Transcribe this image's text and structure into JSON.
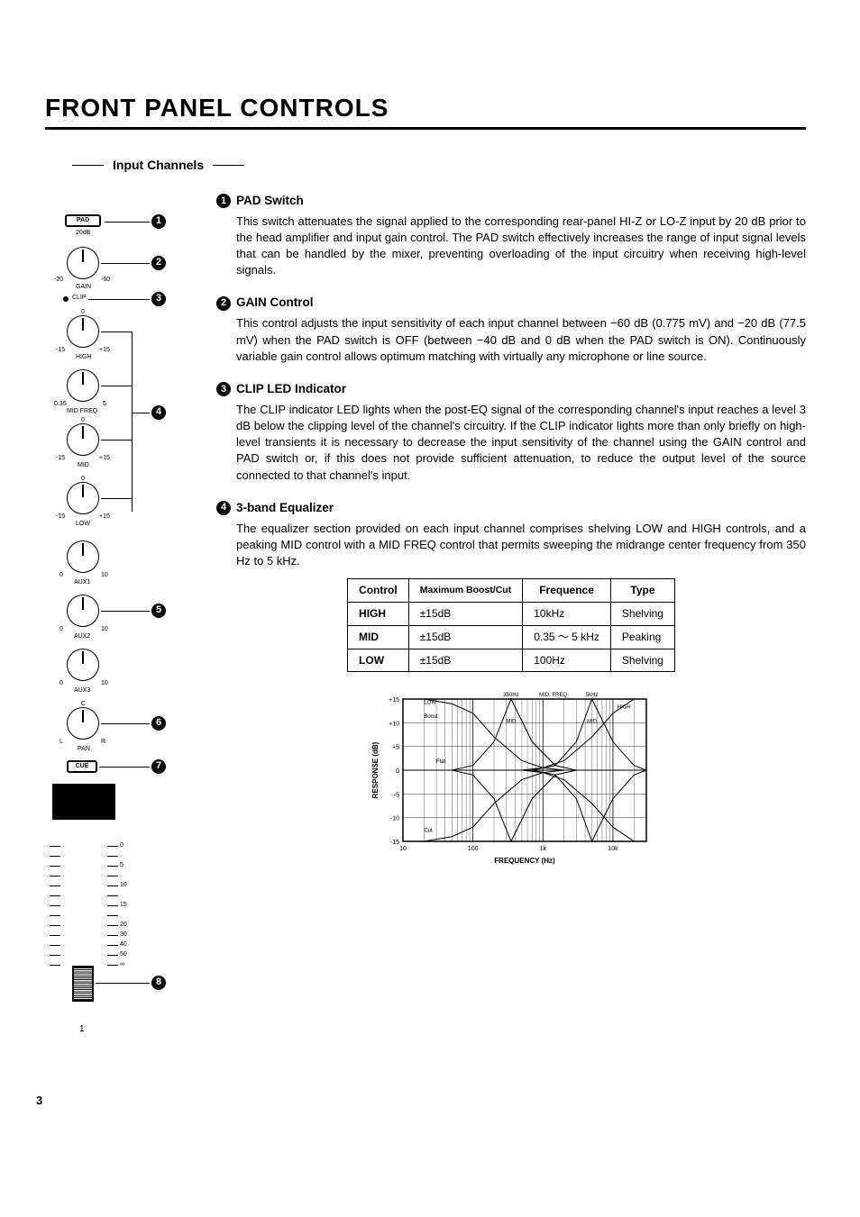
{
  "page_title": "FRONT PANEL CONTROLS",
  "subsection": "Input Channels",
  "page_number": "3",
  "channel_number": "1",
  "diagram": {
    "pad_label": "PAD",
    "pad_value": "20dB",
    "gain_left": "-20",
    "gain_right": "-60",
    "gain_label": "GAIN",
    "clip_label": "CLIP",
    "high_top": "0",
    "high_left": "-15",
    "high_right": "+15",
    "high_label": "HIGH",
    "midfreq_left": "0.35",
    "midfreq_right": "5",
    "midfreq_label": "MID FREQ",
    "mid_top": "0",
    "mid_left": "-15",
    "mid_right": "+15",
    "mid_label": "MID",
    "low_top": "0",
    "low_left": "-15",
    "low_right": "+15",
    "low_label": "LOW",
    "aux1_left": "0",
    "aux1_right": "10",
    "aux1_label": "AUX1",
    "aux2_left": "0",
    "aux2_right": "10",
    "aux2_label": "AUX2",
    "aux3_left": "0",
    "aux3_right": "10",
    "aux3_label": "AUX3",
    "pan_top": "C",
    "pan_left": "L",
    "pan_right": "R",
    "pan_label": "PAN",
    "cue_label": "CUE",
    "fader_marks": [
      "0",
      "5",
      "10",
      "15",
      "20",
      "30",
      "40",
      "50",
      "∞"
    ]
  },
  "sections": [
    {
      "num": "1",
      "title": "PAD Switch",
      "body": "This switch attenuates the signal applied to the corresponding rear-panel HI-Z or LO-Z input by 20 dB prior to the head amplifier and input gain control. The PAD switch effectively increases the range of input signal levels that can be handled by the mixer, preventing overloading of the input circuitry when receiving high-level signals."
    },
    {
      "num": "2",
      "title": "GAIN Control",
      "body": "This control adjusts the input sensitivity of each input channel between −60 dB (0.775 mV) and −20 dB (77.5 mV) when the PAD switch is OFF (between −40 dB and 0 dB when the PAD switch is ON). Continuously variable gain control allows optimum matching with virtually any microphone or line source."
    },
    {
      "num": "3",
      "title": "CLIP LED Indicator",
      "body": "The CLIP indicator LED lights when the post-EQ signal of the corresponding channel's input reaches a level 3 dB below the clipping level of the channel's circuitry. If the CLIP indicator lights more than only briefly on high-level transients it is necessary to decrease the input sensitivity of the channel using the GAIN control and PAD switch or, if this does not provide sufficient attenuation, to reduce the output level of the source connected to that channel's input."
    },
    {
      "num": "4",
      "title": "3-band Equalizer",
      "body": "The equalizer section provided on each input channel comprises shelving LOW and HIGH controls, and a peaking MID control with a MID FREQ control that permits sweeping the midrange center frequency from 350 Hz to 5 kHz."
    }
  ],
  "eq_table": {
    "headers": [
      "Control",
      "Maximum Boost/Cut",
      "Frequence",
      "Type"
    ],
    "rows": [
      [
        "HIGH",
        "±15dB",
        "10kHz",
        "Shelving"
      ],
      [
        "MID",
        "±15dB",
        "0.35 ～ 5 kHz",
        "Peaking"
      ],
      [
        "LOW",
        "±15dB",
        "100Hz",
        "Shelving"
      ]
    ]
  },
  "chart_data": {
    "type": "line",
    "title": "",
    "xlabel": "FREQUENCY (Hz)",
    "ylabel": "RESPONSE (dB)",
    "xscale": "log",
    "xlim": [
      10,
      30000
    ],
    "ylim": [
      -15,
      15
    ],
    "xticks": [
      10,
      100,
      1000,
      10000
    ],
    "xtick_labels": [
      "10",
      "100",
      "1k",
      "10k"
    ],
    "yticks": [
      -15,
      -10,
      -5,
      0,
      5,
      10,
      15
    ],
    "annotations": [
      "LOW",
      "Boost",
      "MID",
      "MID. FREQ",
      "HIGH",
      "Flat",
      "Cut",
      "350Hz",
      "5kHz"
    ],
    "series": [
      {
        "name": "LOW boost",
        "x": [
          10,
          20,
          50,
          100,
          200,
          500,
          1000,
          2000,
          20000
        ],
        "y": [
          15,
          15,
          14,
          12,
          7,
          2,
          0.5,
          0,
          0
        ]
      },
      {
        "name": "LOW cut",
        "x": [
          10,
          20,
          50,
          100,
          200,
          500,
          1000,
          2000,
          20000
        ],
        "y": [
          -15,
          -15,
          -14,
          -12,
          -7,
          -2,
          -0.5,
          0,
          0
        ]
      },
      {
        "name": "MID boost 350Hz",
        "x": [
          50,
          100,
          200,
          350,
          700,
          1500,
          3000,
          20000
        ],
        "y": [
          0,
          1,
          6,
          15,
          6,
          1,
          0,
          0
        ]
      },
      {
        "name": "MID cut 350Hz",
        "x": [
          50,
          100,
          200,
          350,
          700,
          1500,
          3000,
          20000
        ],
        "y": [
          0,
          -1,
          -6,
          -15,
          -6,
          -1,
          0,
          0
        ]
      },
      {
        "name": "MID boost 5kHz",
        "x": [
          700,
          1500,
          3000,
          5000,
          10000,
          20000,
          30000
        ],
        "y": [
          0,
          1,
          6,
          15,
          6,
          1,
          0
        ]
      },
      {
        "name": "MID cut 5kHz",
        "x": [
          700,
          1500,
          3000,
          5000,
          10000,
          20000,
          30000
        ],
        "y": [
          0,
          -1,
          -6,
          -15,
          -6,
          -1,
          0
        ]
      },
      {
        "name": "HIGH boost",
        "x": [
          500,
          1000,
          2000,
          5000,
          10000,
          20000,
          30000
        ],
        "y": [
          0,
          0.5,
          2,
          7,
          12,
          15,
          15
        ]
      },
      {
        "name": "HIGH cut",
        "x": [
          500,
          1000,
          2000,
          5000,
          10000,
          20000,
          30000
        ],
        "y": [
          0,
          -0.5,
          -2,
          -7,
          -12,
          -15,
          -15
        ]
      },
      {
        "name": "Flat",
        "x": [
          10,
          30000
        ],
        "y": [
          0,
          0
        ]
      }
    ]
  }
}
